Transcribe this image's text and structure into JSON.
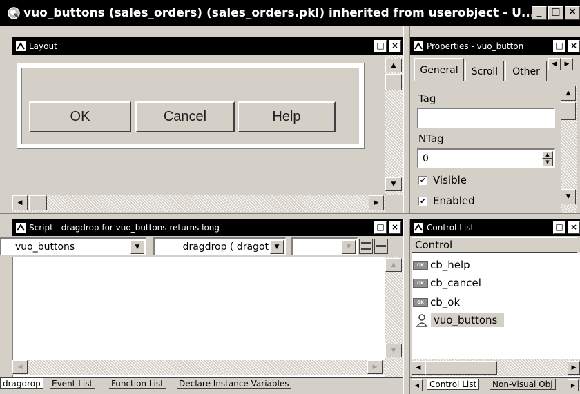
{
  "app": {
    "title": "vuo_buttons (sales_orders) (sales_orders.pkl) inherited from userobject - U...",
    "min": "_",
    "max": "□",
    "close": "×"
  },
  "layout_panel": {
    "title": "Layout",
    "buttons": [
      "OK",
      "Cancel",
      "Help"
    ]
  },
  "properties_panel": {
    "title": "Properties - vuo_button",
    "tabs": [
      "General",
      "Scroll",
      "Other"
    ],
    "tag_label": "Tag",
    "tag_value": "",
    "ntag_label": "NTag",
    "ntag_value": "0",
    "visible_label": "Visible",
    "visible_checked": true,
    "enabled_label": "Enabled",
    "enabled_checked": true
  },
  "script_panel": {
    "title": "Script - dragdrop for vuo_buttons returns long",
    "object_select": "vuo_buttons",
    "event_select": "dragdrop ( dragot",
    "third_select": "",
    "bottom_tabs": [
      "dragdrop",
      "Event List",
      "Function List",
      "Declare Instance Variables"
    ]
  },
  "control_list_panel": {
    "title": "Control List",
    "header": "Control",
    "items": [
      "cb_help",
      "cb_cancel",
      "cb_ok",
      "vuo_buttons"
    ],
    "selected_index": 3,
    "bottom_tabs": [
      "Control List",
      "Non-Visual Obj"
    ]
  },
  "icons": {
    "ok_badge_text": "OK",
    "checkmark": "✔"
  },
  "colors": {
    "face": "#d4d0c8",
    "titlebar": "#000000",
    "selection": "#d4d0c8"
  }
}
